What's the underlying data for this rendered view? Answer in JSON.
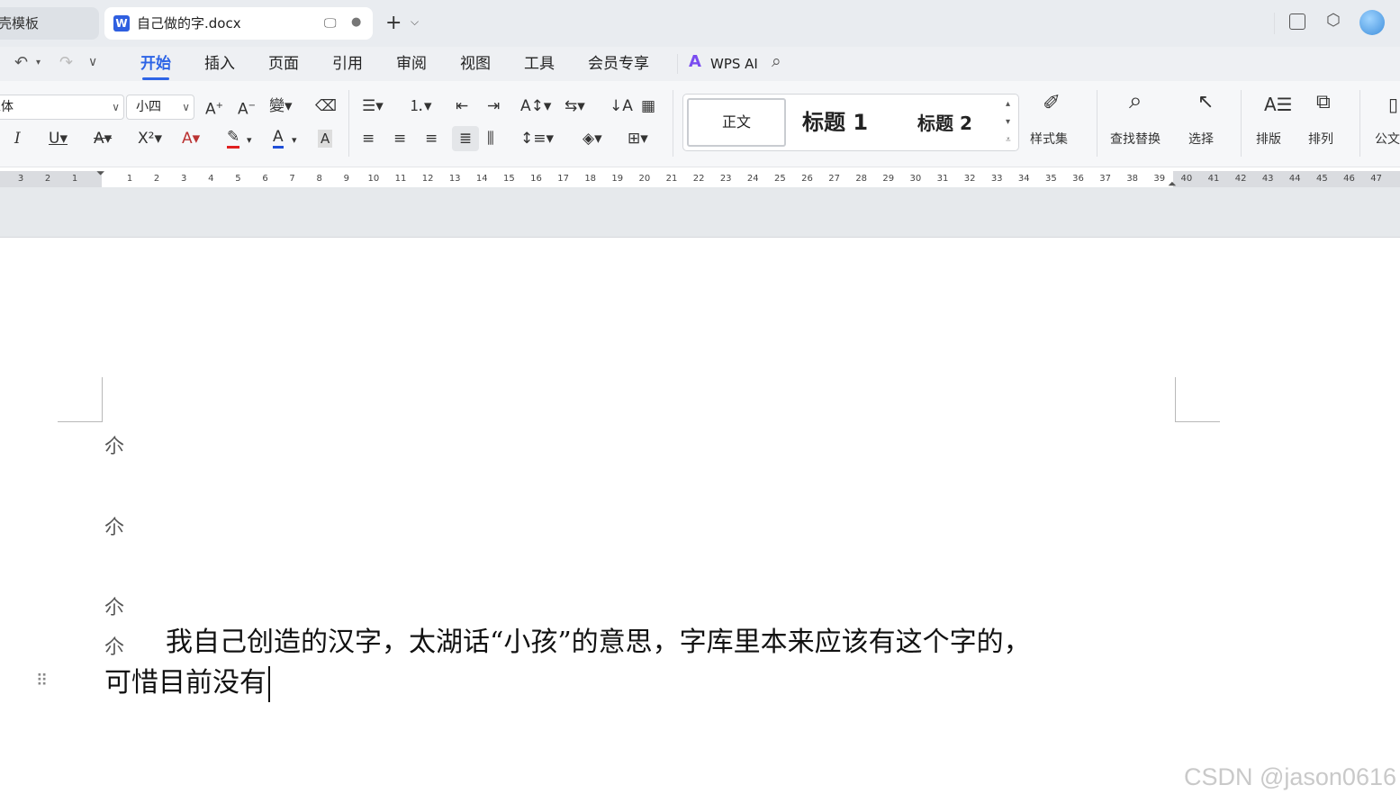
{
  "tabs": [
    {
      "label": "找稻壳模板"
    },
    {
      "label": "自己做的字.docx"
    }
  ],
  "menu": [
    "开始",
    "插入",
    "页面",
    "引用",
    "审阅",
    "视图",
    "工具",
    "会员专享"
  ],
  "wps_ai_label": "WPS AI",
  "font": {
    "name": "宋体",
    "size": "小四"
  },
  "styles": {
    "normal": "正文",
    "heading1": "标题 1",
    "heading2": "标题 2"
  },
  "ribbon_labels": {
    "style_set": "样式集",
    "find_replace": "查找替换",
    "select": "选择",
    "layout": "排版",
    "arrange": "排列",
    "official": "公文"
  },
  "ruler": {
    "left_ticks": [
      "3",
      "2",
      "1"
    ],
    "ticks": [
      "1",
      "2",
      "3",
      "4",
      "5",
      "6",
      "7",
      "8",
      "9",
      "10",
      "11",
      "12",
      "13",
      "14",
      "15",
      "16",
      "17",
      "18",
      "19",
      "20",
      "21",
      "22",
      "23",
      "24",
      "25",
      "26",
      "27",
      "28",
      "29",
      "30",
      "31",
      "32",
      "33",
      "34",
      "35",
      "36",
      "37",
      "38",
      "39",
      "40",
      "41",
      "42",
      "43",
      "44",
      "45",
      "46",
      "47"
    ]
  },
  "document": {
    "glyph": "尒",
    "paragraph_line1": "我自己创造的汉字，太湖话“小孩”的意思，字库里本来应该有这个字的，",
    "paragraph_line2": "可惜目前没有"
  },
  "watermark": "CSDN @jason0616",
  "colors": {
    "accent": "#2d64e6",
    "highlight_bar": "#e02020",
    "font_color_bar": "#1f4fd8"
  }
}
